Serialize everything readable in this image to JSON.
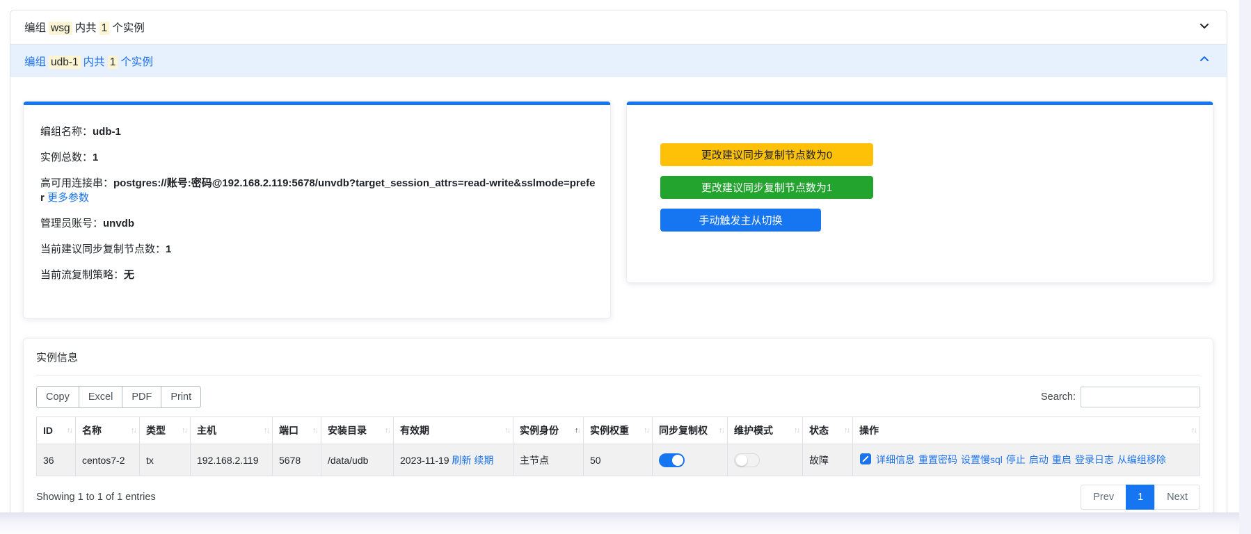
{
  "accordion": [
    {
      "prefix": "编组",
      "group": "wsg",
      "middle": "内共",
      "count": "1",
      "suffix": "个实例",
      "state": "collapsed"
    },
    {
      "prefix": "编组",
      "group": "udb-1",
      "middle": "内共",
      "count": "1",
      "suffix": "个实例",
      "state": "expanded"
    }
  ],
  "group_info": {
    "fields": [
      {
        "label": "编组名称：",
        "value": "udb-1"
      },
      {
        "label": "实例总数：",
        "value": "1"
      },
      {
        "label": "高可用连接串：",
        "value": "postgres://账号:密码@192.168.2.119:5678/unvdb?target_session_attrs=read-write&sslmode=prefer",
        "link": "更多参数"
      },
      {
        "label": "管理员账号：",
        "value": "unvdb"
      },
      {
        "label": "当前建议同步复制节点数：",
        "value": "1"
      },
      {
        "label": "当前流复制策略：",
        "value": "无"
      }
    ]
  },
  "group_actions": {
    "buttons": [
      {
        "label": "更改建议同步复制节点数为0",
        "color": "#fec107"
      },
      {
        "label": "更改建议同步复制节点数为1",
        "color": "#22a42f"
      },
      {
        "label": "手动触发主从切换",
        "color": "#1675f0"
      }
    ]
  },
  "instances": {
    "title": "实例信息",
    "export_buttons": [
      "Copy",
      "Excel",
      "PDF",
      "Print"
    ],
    "search_label": "Search:",
    "search_value": "",
    "columns": [
      "ID",
      "名称",
      "类型",
      "主机",
      "端口",
      "安装目录",
      "有效期",
      "实例身份",
      "实例权重",
      "同步复制权",
      "维护模式",
      "状态",
      "操作"
    ],
    "sort": {
      "column": "实例身份",
      "direction": "asc"
    },
    "row": {
      "id": "36",
      "name": "centos7-2",
      "type": "tx",
      "host": "192.168.2.119",
      "port": "5678",
      "install_dir": "/data/udb",
      "expiry_date": "2023-11-19",
      "expiry_links": [
        "刷新",
        "续期"
      ],
      "role": "主节点",
      "weight": "50",
      "sync_replication": "on",
      "maintenance_mode": "off",
      "status": "故障",
      "op_links": [
        "详细信息",
        "重置密码",
        "设置慢sql",
        "停止",
        "启动",
        "重启",
        "登录日志",
        "从编组移除"
      ]
    },
    "footer": "Showing 1 to 1 of 1 entries",
    "pagination": {
      "prev": "Prev",
      "current": "1",
      "next": "Next"
    }
  },
  "colors": {
    "accent_blue": "#1675f0",
    "link_blue": "#1a73e8",
    "button_yellow": "#fec107",
    "button_green": "#22a42f",
    "expanded_header_bg": "#e7f1fd",
    "highlight_mark": "#fcf4d3",
    "row_stripe": "#f1f1f1"
  }
}
